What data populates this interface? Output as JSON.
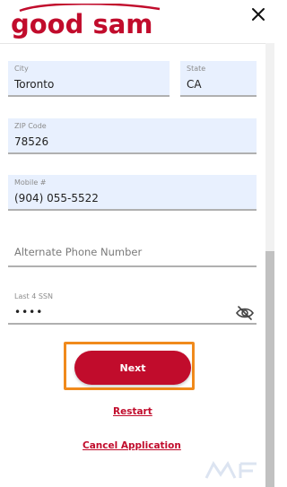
{
  "header": {
    "logo_text": "good sam",
    "close_icon": "close-icon"
  },
  "form": {
    "city": {
      "label": "City",
      "value": "Toronto"
    },
    "state": {
      "label": "State",
      "value": "CA"
    },
    "zip": {
      "label": "ZIP Code",
      "value": "78526"
    },
    "mobile": {
      "label": "Mobile #",
      "value": "(904) 055-5522"
    },
    "alternate_phone": {
      "placeholder": "Alternate Phone Number"
    },
    "ssn": {
      "label": "Last 4 SSN",
      "value": "••••",
      "toggle_icon": "eye-slash-icon"
    }
  },
  "actions": {
    "next_label": "Next",
    "restart_label": "Restart",
    "cancel_label": "Cancel Application"
  },
  "colors": {
    "brand_red": "#c10c2c",
    "focus_orange": "#f08a1c",
    "autofill_blue": "#e8f0fe"
  }
}
